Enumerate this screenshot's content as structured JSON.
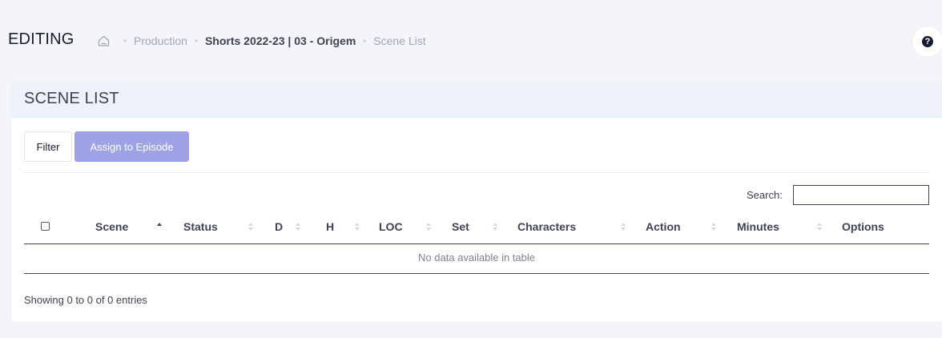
{
  "header": {
    "title": "EDITING",
    "breadcrumb": {
      "home_icon": "home-icon",
      "items": [
        "Production",
        "Shorts 2022-23 | 03 - Origem",
        "Scene List"
      ]
    },
    "help_icon": "question-circle-icon"
  },
  "card": {
    "title": "SCENE LIST",
    "buttons": {
      "filter": "Filter",
      "assign": "Assign to Episode"
    },
    "search": {
      "label": "Search:",
      "value": ""
    },
    "table": {
      "columns": [
        "Scene",
        "Status",
        "D",
        "H",
        "LOC",
        "Set",
        "Characters",
        "Action",
        "Minutes",
        "Options"
      ],
      "sorted_column": "Scene",
      "sort_direction": "ascending",
      "empty_message": "No data available in table"
    },
    "info": "Showing 0 to 0 of 0 entries"
  },
  "colors": {
    "accent_button": "#9ea3e6",
    "header_bg": "#eef3f9",
    "page_bg": "#f4f5f8"
  }
}
